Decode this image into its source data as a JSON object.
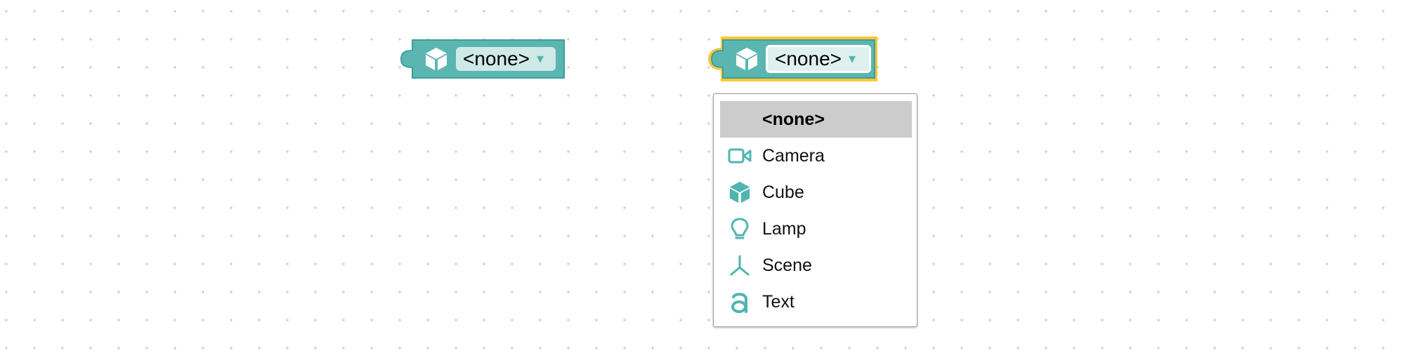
{
  "colors": {
    "block_fill": "#5bb6b2",
    "block_stroke": "#3f9e98",
    "block_selected_outline": "#fcc935",
    "dropdown_field": "#cfe9e7",
    "dropdown_arrow": "#4fb5b0",
    "menu_highlight": "#cccccc",
    "menu_icon": "#4fb5b0",
    "grid_dot": "#cdd3d6"
  },
  "workspace": {
    "blocks": [
      {
        "icon": "cube-icon",
        "dropdown_value": "<none>",
        "dropdown_arrow": "▾",
        "selected": false
      },
      {
        "icon": "cube-icon",
        "dropdown_value": "<none>",
        "dropdown_arrow": "▾",
        "selected": true
      }
    ]
  },
  "dropdown_menu": {
    "items": [
      {
        "label": "<none>",
        "icon": "",
        "highlighted": true
      },
      {
        "label": "Camera",
        "icon": "camera-icon",
        "highlighted": false
      },
      {
        "label": "Cube",
        "icon": "cube-icon",
        "highlighted": false
      },
      {
        "label": "Lamp",
        "icon": "lamp-icon",
        "highlighted": false
      },
      {
        "label": "Scene",
        "icon": "scene-icon",
        "highlighted": false
      },
      {
        "label": "Text",
        "icon": "text-icon",
        "highlighted": false
      }
    ]
  }
}
